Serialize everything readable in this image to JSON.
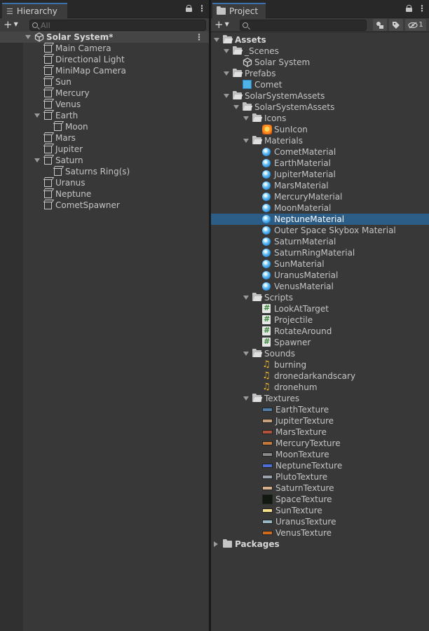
{
  "hierarchy": {
    "tab_label": "Hierarchy",
    "search_placeholder": "All",
    "scene_name": "Solar System*",
    "items": [
      {
        "label": "Main Camera",
        "depth": 1
      },
      {
        "label": "Directional Light",
        "depth": 1
      },
      {
        "label": "MiniMap Camera",
        "depth": 1
      },
      {
        "label": "Sun",
        "depth": 1
      },
      {
        "label": "Mercury",
        "depth": 1
      },
      {
        "label": "Venus",
        "depth": 1
      },
      {
        "label": "Earth",
        "depth": 1,
        "expanded": true
      },
      {
        "label": "Moon",
        "depth": 2
      },
      {
        "label": "Mars",
        "depth": 1
      },
      {
        "label": "Jupiter",
        "depth": 1
      },
      {
        "label": "Saturn",
        "depth": 1,
        "expanded": true
      },
      {
        "label": "Saturns Ring(s)",
        "depth": 2
      },
      {
        "label": "Uranus",
        "depth": 1
      },
      {
        "label": "Neptune",
        "depth": 1
      },
      {
        "label": "CometSpawner",
        "depth": 1
      }
    ]
  },
  "project": {
    "tab_label": "Project",
    "search_value": "",
    "visibility_count": "1",
    "items": [
      {
        "label": "Assets",
        "depth": 0,
        "type": "folder",
        "expanded": true,
        "bold": true
      },
      {
        "label": "_Scenes",
        "depth": 1,
        "type": "folder",
        "expanded": true
      },
      {
        "label": "Solar System",
        "depth": 2,
        "type": "scene"
      },
      {
        "label": "Prefabs",
        "depth": 1,
        "type": "folder",
        "expanded": true
      },
      {
        "label": "Comet",
        "depth": 2,
        "type": "prefab"
      },
      {
        "label": "SolarSystemAssets",
        "depth": 1,
        "type": "folder",
        "expanded": true
      },
      {
        "label": "SolarSystemAssets",
        "depth": 2,
        "type": "folder",
        "expanded": true
      },
      {
        "label": "Icons",
        "depth": 3,
        "type": "folder",
        "expanded": true
      },
      {
        "label": "SunIcon",
        "depth": 4,
        "type": "sunicon"
      },
      {
        "label": "Materials",
        "depth": 3,
        "type": "folder",
        "expanded": true
      },
      {
        "label": "CometMaterial",
        "depth": 4,
        "type": "material"
      },
      {
        "label": "EarthMaterial",
        "depth": 4,
        "type": "material"
      },
      {
        "label": "JupiterMaterial",
        "depth": 4,
        "type": "material"
      },
      {
        "label": "MarsMaterial",
        "depth": 4,
        "type": "material"
      },
      {
        "label": "MercuryMaterial",
        "depth": 4,
        "type": "material"
      },
      {
        "label": "MoonMaterial",
        "depth": 4,
        "type": "material"
      },
      {
        "label": "NeptuneMaterial",
        "depth": 4,
        "type": "material",
        "selected": true
      },
      {
        "label": "Outer Space Skybox Material",
        "depth": 4,
        "type": "material"
      },
      {
        "label": "SaturnMaterial",
        "depth": 4,
        "type": "material"
      },
      {
        "label": "SaturnRingMaterial",
        "depth": 4,
        "type": "material"
      },
      {
        "label": "SunMaterial",
        "depth": 4,
        "type": "material"
      },
      {
        "label": "UranusMaterial",
        "depth": 4,
        "type": "material"
      },
      {
        "label": "VenusMaterial",
        "depth": 4,
        "type": "material"
      },
      {
        "label": "Scripts",
        "depth": 3,
        "type": "folder",
        "expanded": true
      },
      {
        "label": "LookAtTarget",
        "depth": 4,
        "type": "script"
      },
      {
        "label": "Projectile",
        "depth": 4,
        "type": "script"
      },
      {
        "label": "RotateAround",
        "depth": 4,
        "type": "script"
      },
      {
        "label": "Spawner",
        "depth": 4,
        "type": "script"
      },
      {
        "label": "Sounds",
        "depth": 3,
        "type": "folder",
        "expanded": true
      },
      {
        "label": "burning",
        "depth": 4,
        "type": "audio"
      },
      {
        "label": "dronedarkandscary",
        "depth": 4,
        "type": "audio"
      },
      {
        "label": "dronehum",
        "depth": 4,
        "type": "audio"
      },
      {
        "label": "Textures",
        "depth": 3,
        "type": "folder",
        "expanded": true
      },
      {
        "label": "EarthTexture",
        "depth": 4,
        "type": "texture",
        "color": "#4f7da6"
      },
      {
        "label": "JupiterTexture",
        "depth": 4,
        "type": "texture",
        "color": "#c9a27a"
      },
      {
        "label": "MarsTexture",
        "depth": 4,
        "type": "texture",
        "color": "#b0533a"
      },
      {
        "label": "MercuryTexture",
        "depth": 4,
        "type": "texture",
        "color": "#c47a3a"
      },
      {
        "label": "MoonTexture",
        "depth": 4,
        "type": "texture",
        "color": "#8a8a8a"
      },
      {
        "label": "NeptuneTexture",
        "depth": 4,
        "type": "texture",
        "color": "#4a6fd6"
      },
      {
        "label": "PlutoTexture",
        "depth": 4,
        "type": "texture",
        "color": "#9aa3ad"
      },
      {
        "label": "SaturnTexture",
        "depth": 4,
        "type": "texture",
        "color": "#d8b08a"
      },
      {
        "label": "SpaceTexture",
        "depth": 4,
        "type": "texture",
        "color": "#101810",
        "big": true
      },
      {
        "label": "SunTexture",
        "depth": 4,
        "type": "texture",
        "color": "#f3e08a"
      },
      {
        "label": "UranusTexture",
        "depth": 4,
        "type": "texture",
        "color": "#9ab7c6"
      },
      {
        "label": "VenusTexture",
        "depth": 4,
        "type": "texture",
        "color": "#c96a1e"
      },
      {
        "label": "Packages",
        "depth": 0,
        "type": "folder",
        "expanded": false,
        "bold": true
      }
    ]
  }
}
